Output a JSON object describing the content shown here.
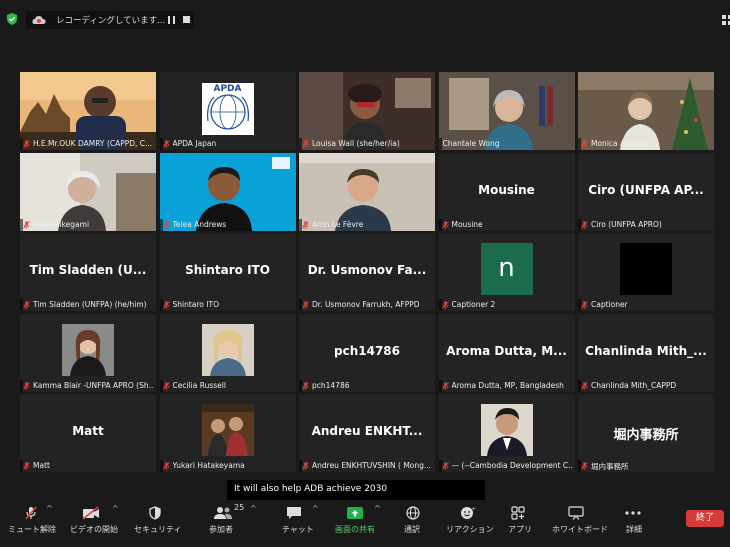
{
  "top_bar": {
    "recording_label": "レコーディングしています...",
    "view_label": "表示"
  },
  "tiles": [
    {
      "name": "H.E.Mr.OUK DAMRY (CAPPD, C...",
      "muted": true,
      "media": "video",
      "scene": "angkor"
    },
    {
      "name": "APDA Japan",
      "muted": true,
      "media": "logo",
      "logo_text": "APDA"
    },
    {
      "name": "Louisa Wall (she/her/ia)",
      "muted": true,
      "media": "video",
      "scene": "louisa"
    },
    {
      "name": "Chantale Wong",
      "muted": false,
      "media": "video",
      "scene": "chantale",
      "active_speaker": true
    },
    {
      "name": "Monica Adame",
      "muted": true,
      "media": "video",
      "scene": "monica"
    },
    {
      "name": "kiyoko ikegami",
      "muted": true,
      "media": "video",
      "scene": "kiyoko"
    },
    {
      "name": "Telea Andrews",
      "muted": true,
      "media": "video",
      "scene": "telea"
    },
    {
      "name": "Aron Le Fèvre",
      "muted": true,
      "media": "video",
      "scene": "aron"
    },
    {
      "name": "Mousine",
      "muted": true,
      "media": "name",
      "display": "Mousine"
    },
    {
      "name": "Ciro (UNFPA APRO)",
      "muted": true,
      "media": "name",
      "display": "Ciro (UNFPA AP..."
    },
    {
      "name": "Tim Sladden (UNFPA) (he/him)",
      "muted": true,
      "media": "name",
      "display": "Tim Sladden (U..."
    },
    {
      "name": "Shintaro ITO",
      "muted": true,
      "media": "name",
      "display": "Shintaro ITO"
    },
    {
      "name": "Dr. Usmonov Farrukh, AFPPD",
      "muted": true,
      "media": "name",
      "display": "Dr. Usmonov Fa..."
    },
    {
      "name": "Captioner 2",
      "muted": true,
      "media": "letter",
      "letter": "n"
    },
    {
      "name": "Captioner",
      "muted": true,
      "media": "black"
    },
    {
      "name": "Kamma Blair -UNFPA APRO (Sh...",
      "muted": true,
      "media": "photo",
      "scene": "kamma"
    },
    {
      "name": "Cecilia Russell",
      "muted": true,
      "media": "photo",
      "scene": "cecilia"
    },
    {
      "name": "pch14786",
      "muted": true,
      "media": "name",
      "display": "pch14786"
    },
    {
      "name": "Aroma Dutta, MP, Bangladesh",
      "muted": true,
      "media": "name",
      "display": "Aroma Dutta, M..."
    },
    {
      "name": "Chanlinda Mith_CAPPD",
      "muted": true,
      "media": "name",
      "display": "Chanlinda Mith_..."
    },
    {
      "name": "Matt",
      "muted": true,
      "media": "name",
      "display": "Matt"
    },
    {
      "name": "Yukari Hatakeyama",
      "muted": true,
      "media": "photo",
      "scene": "yukari"
    },
    {
      "name": "Andreu ENKHTUVSHIN ( Mong...",
      "muted": true,
      "media": "name",
      "display": "Andreu ENKHT..."
    },
    {
      "name": "— (--Cambodia Development C...",
      "muted": true,
      "media": "photo",
      "scene": "cambodia"
    },
    {
      "name": "堀内事務所",
      "muted": true,
      "media": "name",
      "display": "堀内事務所"
    }
  ],
  "live_caption": "It will also help ADB achieve 2030",
  "toolbar": {
    "mute": "ミュート解除",
    "video": "ビデオの開始",
    "security": "セキュリティ",
    "participants": "参加者",
    "participants_count": "25",
    "chat": "チャット",
    "share": "画面の共有",
    "interpretation": "通訳",
    "reactions": "リアクション",
    "apps": "アプリ",
    "whiteboard": "ホワイトボード",
    "more": "詳細",
    "end": "終了"
  },
  "colors": {
    "active_speaker_border": "#c9e64a",
    "share_green": "#23b14d",
    "end_red": "#d63b3b",
    "shield_green": "#2bbd4c",
    "recording_red": "#e0453a",
    "mute_red": "#e0453a",
    "captioner2_avatar": "#1b6b4c"
  }
}
